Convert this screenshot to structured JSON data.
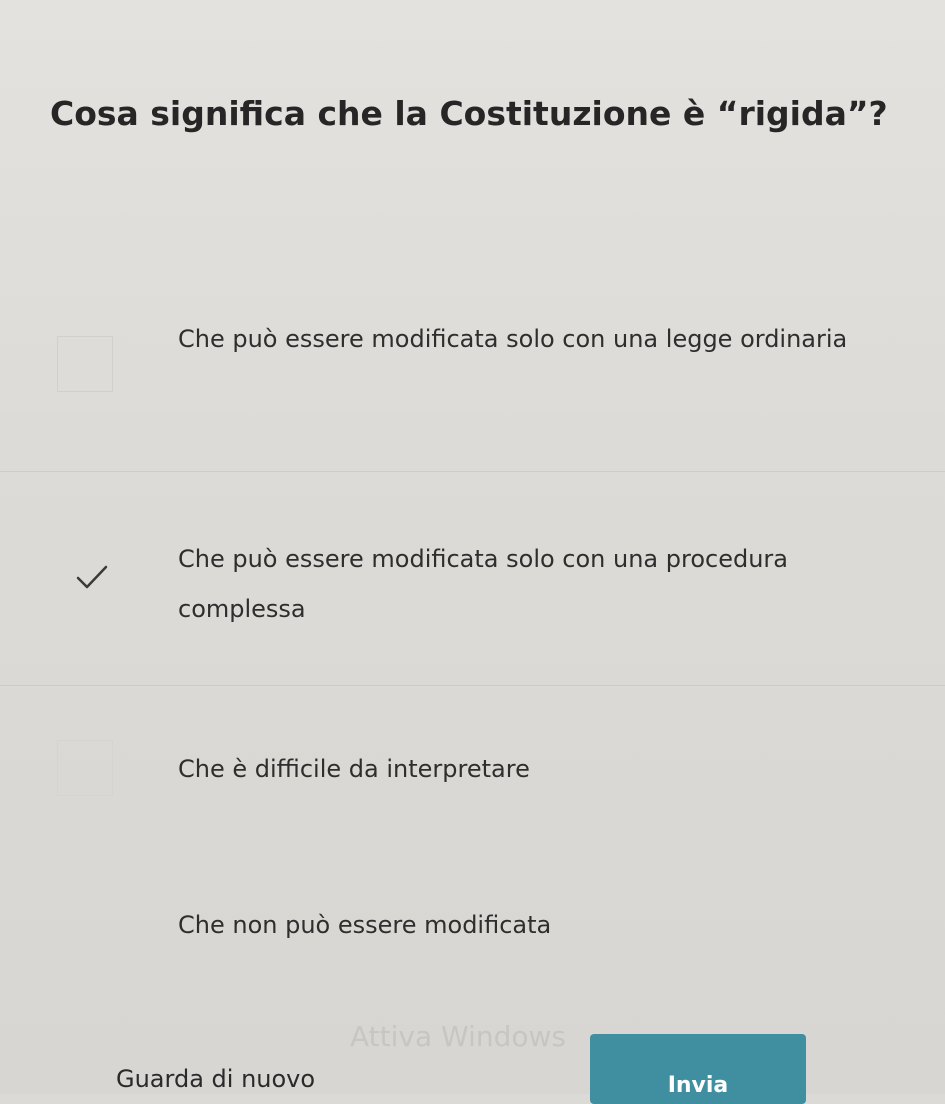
{
  "question": {
    "text": "Cosa significa che la Costituzione è “rigida”?"
  },
  "options": [
    {
      "label": "Che può essere modificata solo con una legge ordinaria",
      "selected": false
    },
    {
      "label": "Che può essere modificata solo con una procedura complessa",
      "selected": true
    },
    {
      "label": "Che è difficile da interpretare",
      "selected": false
    },
    {
      "label": "Che non può essere modificata",
      "selected": false
    }
  ],
  "footer": {
    "back_label": "Guarda di nuovo",
    "submit_label": "Invia"
  },
  "watermark": {
    "text": "Attiva Windows"
  },
  "colors": {
    "accent": "#3f8fa0",
    "background": "#dddbd7",
    "text": "#2b2b2b"
  }
}
